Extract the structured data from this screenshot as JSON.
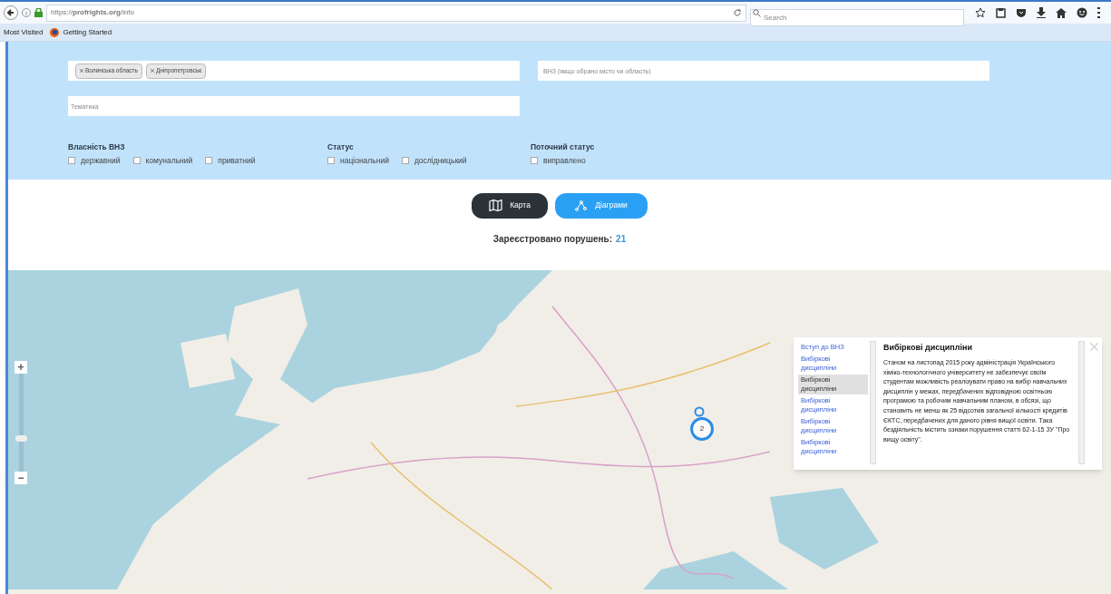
{
  "browser": {
    "url": "https://**profrights.org**/info",
    "search_placeholder": "Search",
    "bookmarks": [
      {
        "label": "Most Visited",
        "kind": "folder"
      },
      {
        "label": "Getting Started",
        "kind": "firefox"
      }
    ]
  },
  "filters": {
    "region_tags": [
      "Волинська область",
      "Дніпропетровськ"
    ],
    "university_placeholder": "ВНЗ (якщо обрано місто чи область)",
    "topic_placeholder": "Тематика",
    "groups": [
      {
        "title": "Власність ВНЗ",
        "options": [
          {
            "label": "державний",
            "checked": false
          },
          {
            "label": "комунальний",
            "checked": false
          },
          {
            "label": "приватний",
            "checked": false
          }
        ]
      },
      {
        "title": "Статус",
        "options": [
          {
            "label": "національний",
            "checked": false
          },
          {
            "label": "дослідницький",
            "checked": false
          }
        ]
      },
      {
        "title": "Поточний статус",
        "options": [
          {
            "label": "виправлено",
            "checked": false
          }
        ]
      }
    ]
  },
  "view_buttons": [
    {
      "label": "Карта",
      "kind": "map",
      "selected": true
    },
    {
      "label": "Діаграми",
      "kind": "chart",
      "selected": false
    }
  ],
  "count": {
    "label": "Зареєстровано порушень:",
    "value": "21"
  },
  "map": {
    "zoom": {
      "in_label": "+",
      "out_label": "−",
      "level": 0.33
    },
    "cluster_count": "2",
    "popup": {
      "tabs": [
        {
          "label": "Вступ до ВНЗ",
          "selected": false
        },
        {
          "label": "Вибіркові дисципліни",
          "selected": false
        },
        {
          "label": "Вибіркові дисципліни",
          "selected": true
        },
        {
          "label": "Вибіркові дисципліни",
          "selected": false
        },
        {
          "label": "Вибіркові дисципліни",
          "selected": false
        },
        {
          "label": "Вибіркові дисципліни",
          "selected": false
        }
      ],
      "title": "Вибіркові дисципліни",
      "body": "Станом на листопад 2015 року адміністрація Українського хіміко-технологічного університету не забезпечує своїм студентам можливість реалізувати право на вибір навчальних дисциплін у межах, передбачених відповідною освітньою програмою та робочим навчальним планом, в обсязі, що становить не менш як 25 відсотків загальної кількості кредитів ЄКТС, передбачених для даного рівня вищої освіти. Така бездіяльність містить ознаки порушення статті 62-1-15 ЗУ \"Про вищу освіту\"."
    }
  }
}
